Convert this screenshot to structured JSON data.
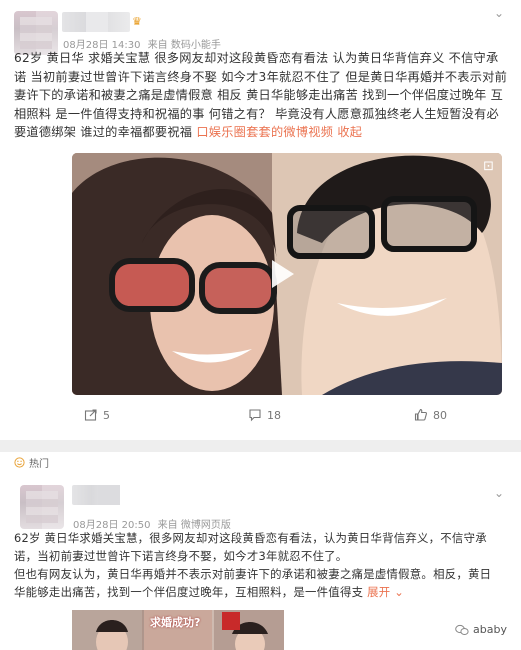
{
  "post1": {
    "badge": "♛",
    "time": "08月28日 14:30",
    "source_prefix": "来自",
    "source": "数码小能手",
    "paragraph": "62岁 黄日华 求婚关宝慧 很多网友却对这段黄昏恋有看法 认为黄日华背信弃义 不信守承诺 当初前妻过世曾许下诺言终身不娶 如今才3年就忍不住了 但是黄日华再婚并不表示对前妻许下的承诺和被妻之痛是虚情假意 相反 黄日华能够走出痛苦 找到一个伴侣度过晚年 互相照料 是一件值得支持和祝福的事 何错之有？ 毕竟没有人愿意孤独终老人生短暂没有必要道德绑架 谁过的幸福都要祝福",
    "link": "口娱乐圈套套的微博视频",
    "link_suffix": "收起",
    "video_tag": "⊡",
    "actions": {
      "share": "5",
      "comments": "18",
      "likes": "80"
    }
  },
  "hot_label": "热门",
  "post2": {
    "time": "08月28日 20:50",
    "source_prefix": "来自",
    "source": "微博网页版",
    "para1": "62岁 黄日华求婚关宝慧，很多网友却对这段黄昏恋有看法，认为黄日华背信弃义，不信守承诺，当初前妻过世曾许下诺言终身不娶，如今才3年就忍不住了。",
    "para2": "但也有网友认为，黄日华再婚并不表示对前妻许下的承诺和被妻之痛是虚情假意。相反，黄日华能够走出痛苦，找到一个伴侣度过晚年，互相照料，是一件值得支",
    "expand": "展开",
    "collage_caption": "求婚成功?"
  },
  "watermark": "ababy",
  "colors": {
    "accent": "#eb7350",
    "vip": "#e89a1c",
    "meta": "#999999",
    "separator": "#eeeeee"
  }
}
